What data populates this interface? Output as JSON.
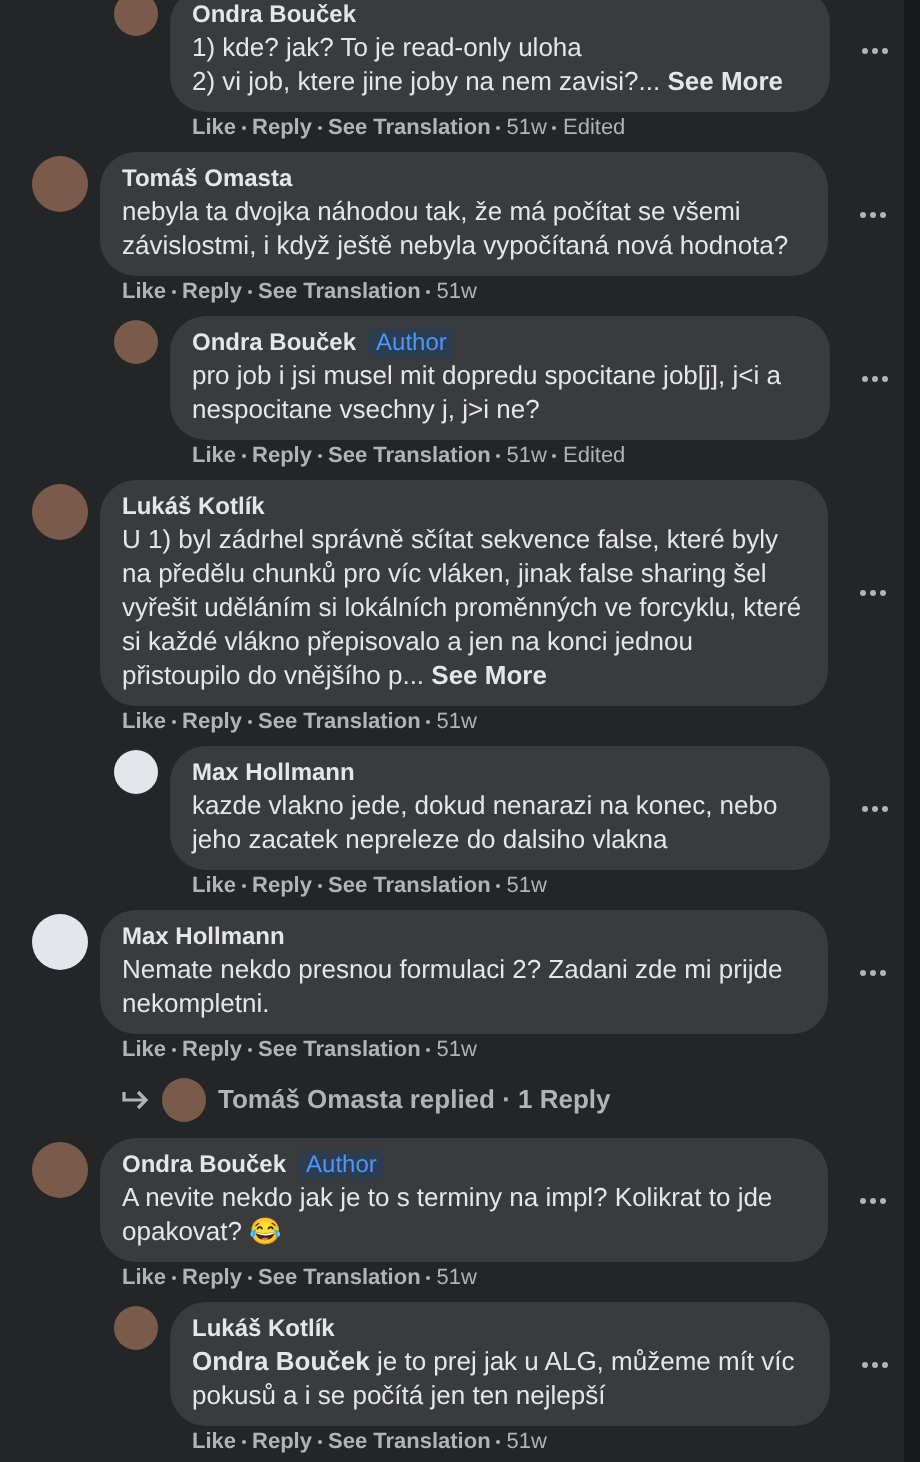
{
  "comments": [
    {
      "children": [
        {
          "author": "Ondra Bouček",
          "kind": "photo",
          "text": "1) kde? jak? To je read-only uloha\n2) vi job, ktere jine joby na nem zavisi?... **See More**",
          "actions": [
            "Like",
            "Reply",
            "See Translation",
            "51w",
            "Edited"
          ]
        }
      ]
    },
    {
      "author": "Tomáš Omasta",
      "kind": "photo",
      "text": "nebyla ta dvojka náhodou tak, že má počítat se všemi závislostmi, i když ještě nebyla vypočítaná nová hodnota?",
      "actions": [
        "Like",
        "Reply",
        "See Translation",
        "51w"
      ],
      "children": [
        {
          "author": "Ondra Bouček",
          "badge": "Author",
          "kind": "photo",
          "text": "pro job i jsi musel mit dopredu spocitane job[j], j<i a nespocitane vsechny j, j>i ne?",
          "actions": [
            "Like",
            "Reply",
            "See Translation",
            "51w",
            "Edited"
          ]
        }
      ]
    },
    {
      "author": "Lukáš Kotlík",
      "kind": "photo",
      "text": "U 1) byl zádrhel správně sčítat sekvence false, které byly na předělu chunků pro víc vláken, jinak false sharing šel vyřešit uděláním si lokálních proměnných ve forcyklu, které si každé vlákno přepisovalo a jen na konci jednou přistoupilo do vnějšího p... **See More**",
      "actions": [
        "Like",
        "Reply",
        "See Translation",
        "51w"
      ],
      "children": [
        {
          "author": "Max Hollmann",
          "kind": "default",
          "text": "kazde vlakno jede, dokud nenarazi na konec, nebo jeho zacatek nepreleze do dalsiho vlakna",
          "actions": [
            "Like",
            "Reply",
            "See Translation",
            "51w"
          ]
        }
      ]
    },
    {
      "author": "Max Hollmann",
      "kind": "default",
      "text": "Nemate nekdo presnou formulaci 2? Zadani zde mi prijde nekompletni.",
      "actions": [
        "Like",
        "Reply",
        "See Translation",
        "51w"
      ],
      "replies_summary": "Tomáš Omasta replied · 1 Reply"
    },
    {
      "author": "Ondra Bouček",
      "badge": "Author",
      "kind": "photo",
      "text": "A nevite nekdo jak je to s terminy na impl? Kolikrat to jde opakovat? 😂",
      "actions": [
        "Like",
        "Reply",
        "See Translation",
        "51w"
      ],
      "children": [
        {
          "author": "Lukáš Kotlík",
          "kind": "photo",
          "text": "**Ondra Bouček** je to prej jak u ALG, můžeme mít víc pokusů a i se počítá jen ten nejlepší",
          "actions": [
            "Like",
            "Reply",
            "See Translation",
            "51w"
          ]
        }
      ]
    }
  ]
}
